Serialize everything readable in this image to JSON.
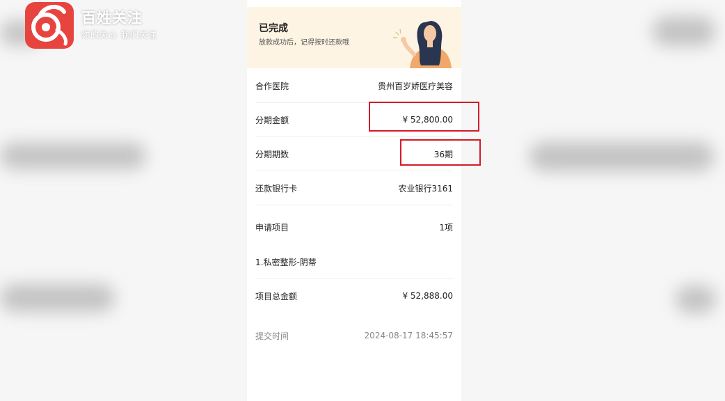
{
  "logo": {
    "name": "百姓关注",
    "slogan": "你的关心 我们关注",
    "icon": "logo-badge-icon"
  },
  "banner": {
    "title": "已完成",
    "subtitle": "放款成功后，记得按时还款哦"
  },
  "details": [
    {
      "label": "合作医院",
      "value": "贵州百岁娇医疗美容"
    },
    {
      "label": "分期金额",
      "value": "¥ 52,800.00"
    },
    {
      "label": "分期期数",
      "value": "36期"
    },
    {
      "label": "还款银行卡",
      "value": "农业银行3161"
    },
    {
      "label": "申请项目",
      "value": "1项"
    },
    {
      "label": "1.私密整形-阴蒂",
      "value": ""
    },
    {
      "label": "项目总金额",
      "value": "¥ 52,888.00"
    },
    {
      "label": "提交时间",
      "value": "2024-08-17 18:45:57"
    }
  ],
  "highlight_color": "#d61a28",
  "accent_color": "#fdf4e3"
}
